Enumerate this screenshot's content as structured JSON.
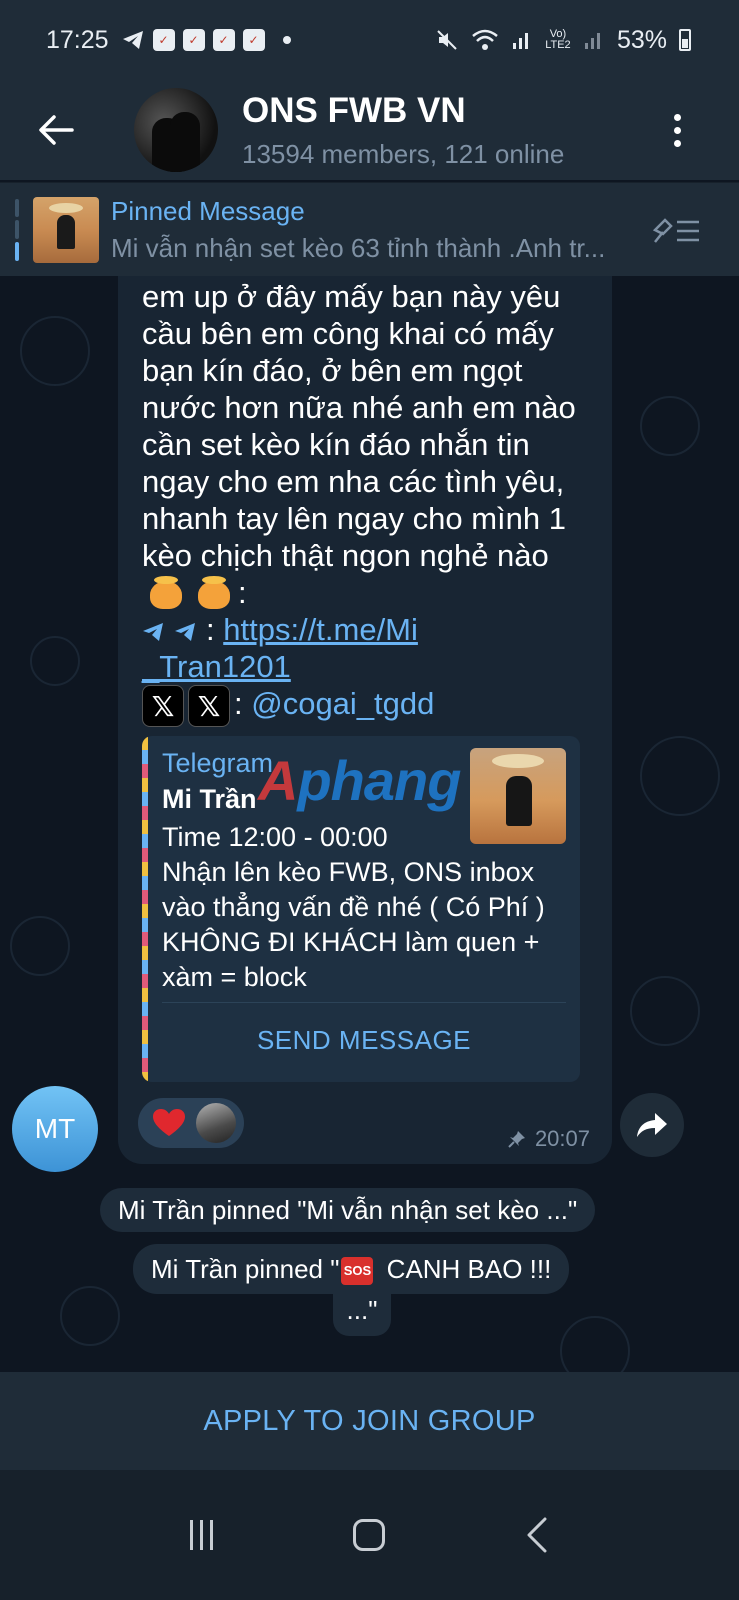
{
  "status_bar": {
    "time": "17:25",
    "battery": "53%",
    "network_label": "Vo) LTE2"
  },
  "header": {
    "title": "ONS FWB VN",
    "subtitle": "13594 members, 121 online"
  },
  "pinned": {
    "title": "Pinned Message",
    "text": "Mi vẫn nhận set kèo 63 tỉnh thành .Anh tr..."
  },
  "message": {
    "text": "em up ở đây mấy bạn này yêu cầu bên em công khai có mấy bạn kín đáo, ở bên em ngọt nước hơn nữa nhé anh em nào cần set kèo kín đáo nhắn tin ngay cho em nha các tình yêu, nhanh tay lên ngay cho mình 1 kèo chịch thật ngon nghẻ nào",
    "colon_after_emoji": ":",
    "link_label_sep": ": ",
    "link": "https://t.me/Mi_Tran1201",
    "link_line1": "https://t.me/Mi",
    "link_line2": "_Tran1201",
    "x_glyph": "𝕏",
    "mention": "@cogai_tgdd",
    "time": "20:07"
  },
  "preview": {
    "site": "Telegram",
    "name": "Mi Trần",
    "description": "Time 12:00 - 00:00\nNhận lên kèo FWB, ONS inbox vào thẳng vấn đề nhé ( Có Phí ) KHÔNG ĐI KHÁCH làm quen + xàm = block",
    "button": "SEND MESSAGE"
  },
  "watermark": {
    "first": "A",
    "rest": "phang"
  },
  "sender": {
    "initials": "MT"
  },
  "service_messages": {
    "first": "Mi Trần pinned \"Mi vẫn nhận set kèo ...\"",
    "second_prefix": "Mi Trần pinned \"",
    "second_sos": "SOS",
    "second_suffix": " CANH BAO !!!",
    "second_tail": "...\""
  },
  "join_button": "APPLY TO JOIN GROUP",
  "colors": {
    "accent": "#6ab3f3",
    "background": "#0e1621",
    "bubble": "#182533",
    "bar": "#1f2c38",
    "heart": "#e0282e"
  }
}
